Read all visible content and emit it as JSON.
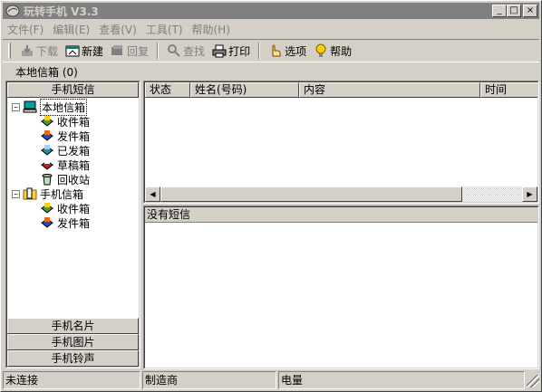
{
  "window": {
    "title": "玩转手机 V3.3",
    "controls": {
      "minimize": "_",
      "maximize": "□",
      "close": "×"
    }
  },
  "menu": [
    "文件(F)",
    "编辑(E)",
    "查看(V)",
    "工具(T)",
    "帮助(H)"
  ],
  "toolbar": {
    "download": "下载",
    "new": "新建",
    "restore": "回复",
    "find": "查找",
    "print": "打印",
    "options": "选项",
    "help": "帮助"
  },
  "location": "本地信箱 (0)",
  "left_panel": {
    "header": "手机短信",
    "tree": {
      "local_root": "本地信箱",
      "local_children": [
        "收件箱",
        "发件箱",
        "已发箱",
        "草稿箱",
        "回收站"
      ],
      "phone_root": "手机信箱",
      "phone_children": [
        "收件箱",
        "发件箱"
      ]
    },
    "bottom_tabs": [
      "手机名片",
      "手机图片",
      "手机铃声"
    ]
  },
  "list": {
    "columns": [
      "状态",
      "姓名(号码)",
      "内容",
      "时间"
    ]
  },
  "preview": {
    "message": "没有短信"
  },
  "statusbar": {
    "connection": "未连接",
    "manufacturer": "制造商",
    "battery": "电量"
  },
  "colors": {
    "face": "#d4d0c8",
    "inactive_title": "#808080",
    "disabled_text": "#808080"
  },
  "icons": {
    "download": "download-icon",
    "new": "new-message-icon",
    "restore": "reply-icon",
    "find": "magnifier-icon",
    "print": "printer-icon",
    "options": "hand-pointer-icon",
    "help": "help-bulb-icon"
  }
}
